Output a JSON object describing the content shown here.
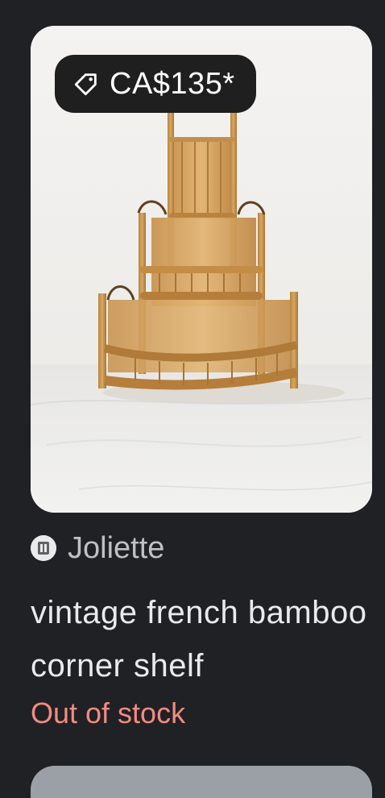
{
  "result": {
    "price": "CA$135*",
    "icons": {
      "price": "tag-icon",
      "source": "store-favicon-icon",
      "photo": "bamboo-corner-shelf-image"
    },
    "source": "Joliette",
    "title": "vintage french bamboo corner shelf",
    "stock_status": "Out of stock"
  },
  "colors": {
    "background": "#202124",
    "stock_status": "#f28b82",
    "text": "#e8eaed",
    "muted": "#bdc1c6"
  }
}
